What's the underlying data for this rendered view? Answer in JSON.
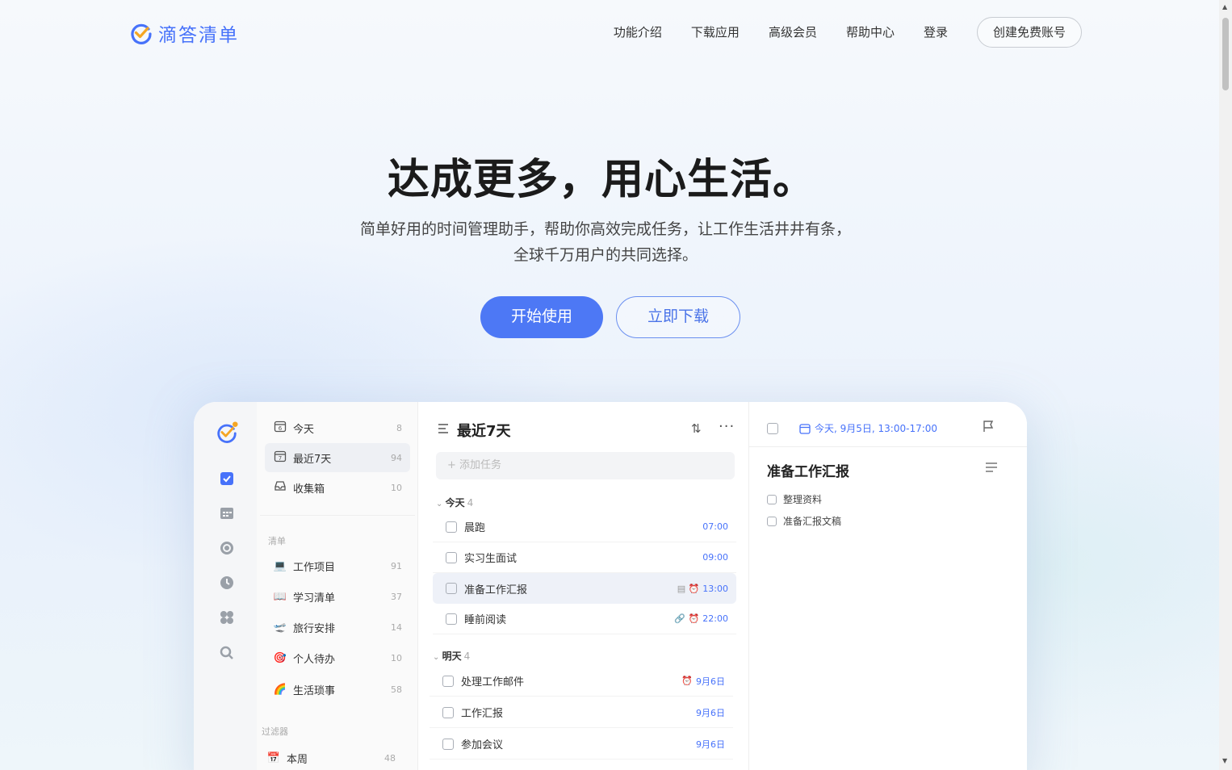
{
  "header": {
    "logo_text": "滴答清单",
    "nav": [
      "功能介绍",
      "下载应用",
      "高级会员",
      "帮助中心",
      "登录"
    ],
    "signup_label": "创建免费账号"
  },
  "hero": {
    "title": "达成更多，用心生活。",
    "subtitle_line1": "简单好用的时间管理助手，帮助你高效完成任务，让工作生活井井有条，",
    "subtitle_line2": "全球千万用户的共同选择。",
    "start_label": "开始使用",
    "download_label": "立即下载"
  },
  "colors": {
    "accent": "#4772fa",
    "button": "#4d78f5"
  },
  "app": {
    "sidebar": {
      "smart": [
        {
          "icon": "calendar-day-icon",
          "glyph": "6",
          "label": "今天",
          "count": "8"
        },
        {
          "icon": "calendar-week-icon",
          "glyph": "7",
          "label": "最近7天",
          "count": "94"
        },
        {
          "icon": "inbox-icon",
          "glyph": "",
          "label": "收集箱",
          "count": "10"
        }
      ],
      "lists_header": "清单",
      "lists": [
        {
          "emoji": "💻",
          "label": "工作项目",
          "count": "91"
        },
        {
          "emoji": "📖",
          "label": "学习清单",
          "count": "37"
        },
        {
          "emoji": "🛫",
          "label": "旅行安排",
          "count": "14"
        },
        {
          "emoji": "🎯",
          "label": "个人待办",
          "count": "10"
        },
        {
          "emoji": "🌈",
          "label": "生活琐事",
          "count": "58"
        }
      ],
      "filters_header": "过滤器",
      "filters": [
        {
          "emoji": "📅",
          "label": "本周",
          "count": "48"
        }
      ]
    },
    "list": {
      "title": "最近7天",
      "add_placeholder": "+ 添加任务",
      "today_header": "今天",
      "today_count": "4",
      "today_tasks": [
        {
          "title": "晨跑",
          "time": "07:00",
          "icons": ""
        },
        {
          "title": "实习生面试",
          "time": "09:00",
          "icons": ""
        },
        {
          "title": "准备工作汇报",
          "time": "13:00",
          "icons": "▤ ⏰"
        },
        {
          "title": "睡前阅读",
          "time": "22:00",
          "icons": "🔗 ⏰"
        }
      ],
      "tomorrow_header": "明天",
      "tomorrow_count": "4",
      "tomorrow_tasks": [
        {
          "title": "处理工作邮件",
          "time": "9月6日",
          "icons": "⏰"
        },
        {
          "title": "工作汇报",
          "time": "9月6日",
          "icons": ""
        },
        {
          "title": "参加会议",
          "time": "9月6日",
          "icons": ""
        }
      ]
    },
    "detail": {
      "date": "今天, 9月5日, 13:00-17:00",
      "title": "准备工作汇报",
      "subtasks": [
        "整理资料",
        "准备汇报文稿"
      ]
    }
  }
}
